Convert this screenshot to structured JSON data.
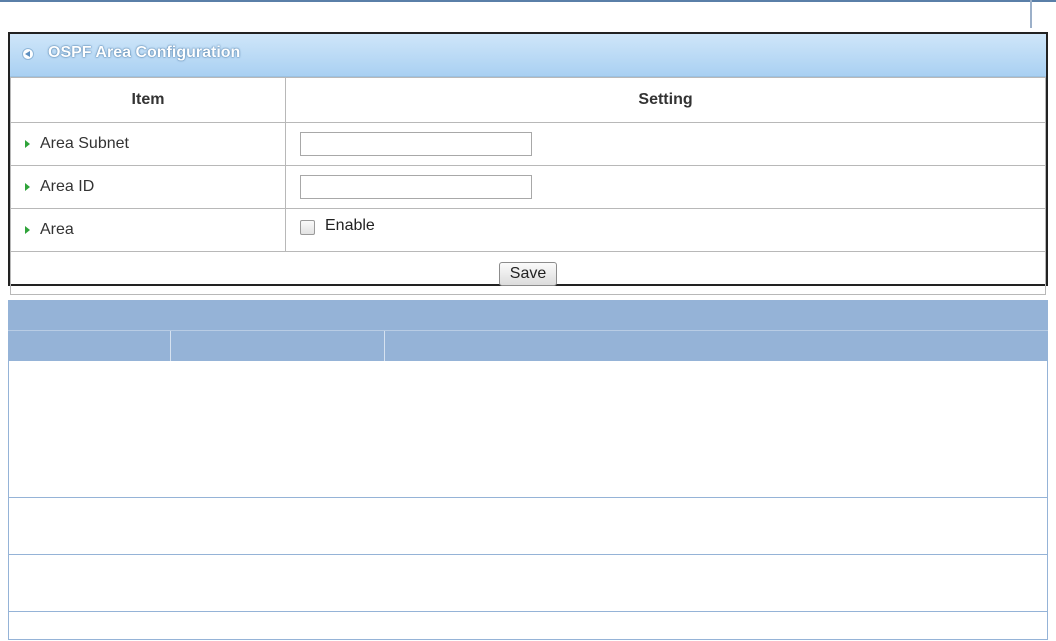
{
  "panel": {
    "title": "OSPF Area Configuration",
    "columns": {
      "item": "Item",
      "setting": "Setting"
    },
    "rows": {
      "area_subnet": {
        "label": "Area Subnet",
        "value": ""
      },
      "area_id": {
        "label": "Area ID",
        "value": ""
      },
      "area": {
        "label": "Area",
        "checkbox_label": "Enable",
        "checked": false
      }
    },
    "save_label": "Save"
  },
  "colors": {
    "header_gradient_top": "#cfe6f9",
    "header_gradient_bottom": "#a9d0f2",
    "row_arrow": "#2fa33a",
    "description_header": "#95b3d7"
  }
}
